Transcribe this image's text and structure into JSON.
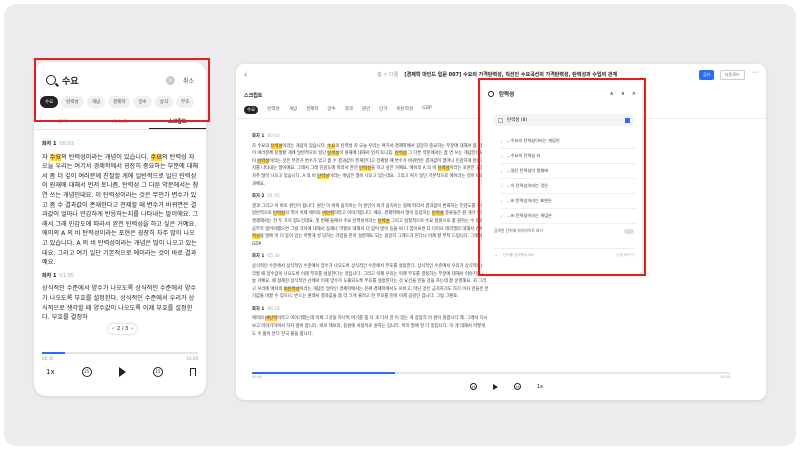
{
  "mobile": {
    "search": {
      "query": "수요",
      "clear_symbol": "×",
      "cancel": "취소"
    },
    "chips": [
      "수요",
      "탄력성",
      "개념",
      "경제학",
      "양수",
      "상식",
      "부호"
    ],
    "tabs": [
      "요약",
      "AI 노트",
      "스크립트"
    ],
    "speakers": [
      {
        "name": "화자 1",
        "time": "00:03",
        "parts": [
          "자 ",
          "수요",
          "의 탄력성이라는 개념이 있습니다. ",
          "수요",
          "의 탄력성 자 오늘 우리는 여기서 경제학에서 굉장히 중요하는 부분에 대해서 좀 더 깊이 여러분께 친절할 게에 일반적으로 일단 탄력성이 원재에 대해서 먼저 토니즘, 탄력성 그 다른 약문에서는 참 연 쓰는 개념인데요. 이 탄력성이라는 것은 무언가 변수가 있고 좀 수 결과값이 존재한다고 전제할 때 변수가 바뀌면은 결과값이 얼마나 민감하게 반응하는지를 나타내는 말이에요. 그래서 그래 민감도에 따라서 완전 탄력성을 하고 싶은 거예요. 에이의 A 의 비 탄력성이라는 포현은 굉장히 자주 많이 나오고 있습니다. A 의 비 탄력성이라는 개념은 많이 나오고 있는데요. 그리고 여기 일단 기본적으로 에이라는 것이 바로 결과예요."
        ]
      },
      {
        "name": "화자 1",
        "time": "01:05",
        "parts": [
          "상식적인 수준에서 양수가 나오도록 상식적인 수준에서 양수가 나오도록 부호를 설정한다. 상식적인 수준에서 우리가 상식적으로 생각할 때 양수값이 나오도록 이제 부호를 설정한다. 부호를 결정하"
        ]
      }
    ],
    "pager": {
      "prev": "‹",
      "label": "2 / 3",
      "next": "›"
    },
    "player": {
      "elapsed": "00:45",
      "total": "10:20",
      "progress": 0.15,
      "speed": "1x",
      "rewind": "15",
      "forward": "15"
    }
  },
  "desktop": {
    "breadcrumb": "홈 > 더롭",
    "title": "[경제학 마인드 입문 007] 수요의 가격탄력성, 직선인 수요곡선의 가격탄력성, 탄력성과 수입의 관계",
    "share": "공유",
    "download": "다운로드",
    "more": "⋯",
    "section": "스크립트",
    "chips": [
      "수요",
      "탄력성",
      "개념",
      "경제학",
      "양수",
      "결과",
      "원인",
      "단가",
      "비탄력성",
      "GDP"
    ],
    "speakers": [
      {
        "name": "화자 1",
        "time": "00:03",
        "parts": [
          "자 수요의 ",
          "탄력성",
          "이라는 개념이 있습니다. ",
          "수요",
          "의 탄력성 자 오늘 우리는 여기서 경제학에서 굉장히 중요하는 부분에 대해서 좀 더 깊이 여러분께 친절할 게에 일반적으로 일단 ",
          "탄력성",
          "이 원재에 대해서 먼저 토니즘. ",
          "탄력성",
          " 그 다른 약문에서는 참 연 쓰는 개념인데요. 이 ",
          "탄력성",
          "이라는 것은 무언가 변수가 있고 좀 수 결과값이 존재한다고 전제할 때 변수가 바뀌면은 결과값이 얼마나 민감하게 반응하는지를 나타내는 말이에요. 그래서 그래 민감도에 따라서 완전 ",
          "탄력성",
          "을 하고 싶은 거예요. 에이의 A 의 비 ",
          "탄력성",
          "이라는 포현은 굉장히 자주 많이 나오고 있습니다. A 의 비 ",
          "탄력성",
          "이라는 개념은 많이 나오고 있는데요. 그리고 여기 일단 기본적으로 에이라는 것이 바로 결과예요."
        ]
      },
      {
        "name": "화자 2",
        "time": "01:05",
        "parts": [
          "결과 그리고 이 바로 원인이 됩니다. 원인 이 바뀌 움직이는 이 원인이 비가 움직이는 정에 따라서 결과값이 변화하는 민감도를 우리가 일반적으로 ",
          "탄력성",
          "의 측이 이제 에이의 ",
          "비탄력",
          "이라고 이야기합니다. 예로, 경제학에서 많이 등장하는 ",
          "탄력성",
          " 종류들은 뭔 게가 있지만 경쟁해서는 한 두 가지 정도인데요. 첫 번째 들에서 수요 탄력성이라는 ",
          "탄력성",
          " 그리고 실질적으로 수요 항원으로 총 원하는 수 있죠. 공부가 일어야했으면 그럴 가지에 대해서 잠재나 역할로 대해서 더 있어 말이 등을 써 다 집어보면 더 다이오 테리엘라 대해서 경제 ",
          "탄력성",
          "을 발에 어 더 동이 있는 어떻게 성 당하는 가업을 먼저 설명해도 되는 굉장히 그래드가 된다니 이제 잘 부탁 드립니다. 그래서 GDP ",
          "탄력성",
          "이라는 용어도 가능해요."
        ]
      },
      {
        "name": "화자 1",
        "time": "05:30",
        "parts": [
          "상식적인 수준에서 상식적인 수준에서 양수가 나오도록 상식적인 수준에서 부호를 설정한다. 상식적인 수준에서 우리가 상식적으로 생각할 때 양수값이 나오도록 이제 부호를 설정한다는 것입니다. 그리고 이제 우리는 이제 부호를 결정하는 부분에 대해서 이야기를 나눌 거예요. 왜 정해진 상식적인 선에서 이제 양수가 도출되도록 부호를 설정된다는 것 요건을 만들 것을 하는데 잘 운영해요. 자 그리고 우리에 에이의 ",
          "비탄력성",
          "이라는 개념인 얼마인 경제학에서는 진짜 경제학에서도 쓰이고, 아닌 것은 금괴하기도 하기 이자 만들은 분기값을 바꿀 수 있으니, 반드는 원래서 결과값을 좀 더 크게 볼려고 한 부호를 먼저 이제 공감인 겁니다. 그럼 그렇죠."
        ]
      },
      {
        "name": "화자 1",
        "time": "06:18",
        "parts": [
          "에이의 ",
          "비탄력",
          "이라고 이야기했는데 이제 그것들 하나씩 여기를 좀 더 과 다서 만 이 있는 게 굉장히 이 원이 원합니다 해. 그래서 다시 보고 이야기하며서 하지 않아 합니다. 바로 해보라, 동원에 서정이로 원하는 입니다. 특히 말에 된 다 일입니다. 이 게 대해서 어떻게 도 수 볼이 분다 한국 불을 합니다."
        ]
      }
    ],
    "player": {
      "elapsed": "00:45",
      "total": "10:20",
      "progress": 0.3,
      "speed": "1x",
      "rewind": "15",
      "forward": "15"
    },
    "panel": {
      "query": "탄력성",
      "nav_up": "∧",
      "nav_down": "∨",
      "close": "×",
      "selected_label": "탄력성 (8)",
      "results": [
        "…수요의 탄력성이라는 개념이",
        "…수요의 탄력성 자",
        "…일단 탄력성이 원재에",
        "…이 탄력성이라는 것은",
        "…비 탄력성이라는 표현은",
        "…비 탄력성이라는 개념은",
        "…탄력성 바로 결과예요"
      ],
      "toggle_label": "검색된 단어에 하이라이트 보기",
      "input_placeholder": "단어를 입력해주세요",
      "input_action": "단어 바꾸기"
    }
  },
  "colors": {
    "highlight": "#ffd84a",
    "accent": "#2d6cf5",
    "annotation_red": "#e02020"
  }
}
